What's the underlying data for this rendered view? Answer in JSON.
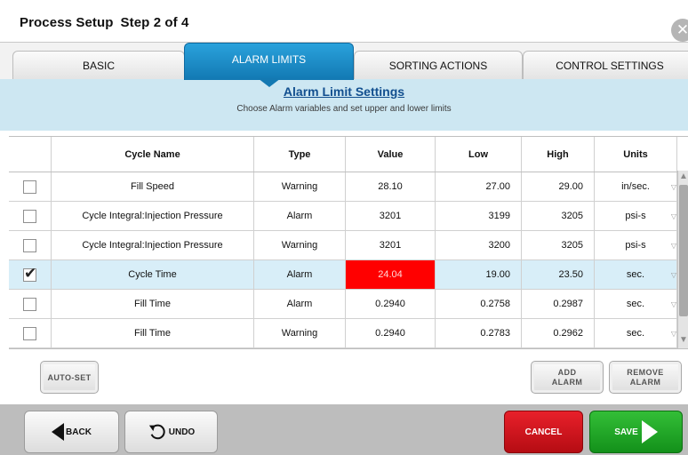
{
  "header": {
    "title": "Process Setup",
    "step": "Step 2 of 4",
    "close_glyph": "✕"
  },
  "tabs": [
    {
      "label": "BASIC",
      "active": false
    },
    {
      "label": "ALARM LIMITS",
      "active": true
    },
    {
      "label": "SORTING ACTIONS",
      "active": false
    },
    {
      "label": "CONTROL SETTINGS",
      "active": false
    }
  ],
  "banner": {
    "title": "Alarm Limit Settings",
    "subtitle": "Choose Alarm variables and set upper and lower limits"
  },
  "table": {
    "columns": [
      "Cycle Name",
      "Type",
      "Value",
      "Low",
      "High",
      "Units"
    ],
    "rows": [
      {
        "checked": false,
        "name": "Fill Speed",
        "type": "Warning",
        "value": "28.10",
        "low": "27.00",
        "high": "29.00",
        "units": "in/sec."
      },
      {
        "checked": false,
        "name": "Cycle Integral:Injection Pressure",
        "type": "Alarm",
        "value": "3201",
        "low": "3199",
        "high": "3205",
        "units": "psi-s"
      },
      {
        "checked": false,
        "name": "Cycle Integral:Injection Pressure",
        "type": "Warning",
        "value": "3201",
        "low": "3200",
        "high": "3205",
        "units": "psi-s"
      },
      {
        "checked": true,
        "name": "Cycle Time",
        "type": "Alarm",
        "value": "24.04",
        "low": "19.00",
        "high": "23.50",
        "units": "sec."
      },
      {
        "checked": false,
        "name": "Fill Time",
        "type": "Alarm",
        "value": "0.2940",
        "low": "0.2758",
        "high": "0.2987",
        "units": "sec."
      },
      {
        "checked": false,
        "name": "Fill Time",
        "type": "Warning",
        "value": "0.2940",
        "low": "0.2783",
        "high": "0.2962",
        "units": "sec."
      }
    ]
  },
  "actions": {
    "auto_set": "AUTO-SET",
    "add_alarm_1": "ADD",
    "add_alarm_2": "ALARM",
    "remove_alarm_1": "REMOVE",
    "remove_alarm_2": "ALARM"
  },
  "footer": {
    "back": "BACK",
    "undo": "UNDO",
    "cancel": "CANCEL",
    "save": "SAVE"
  },
  "colors": {
    "accent": "#1a8bc8",
    "alert": "#ff0000",
    "cancel": "#d5161f",
    "save": "#22a728",
    "banner": "#cde7f2"
  }
}
